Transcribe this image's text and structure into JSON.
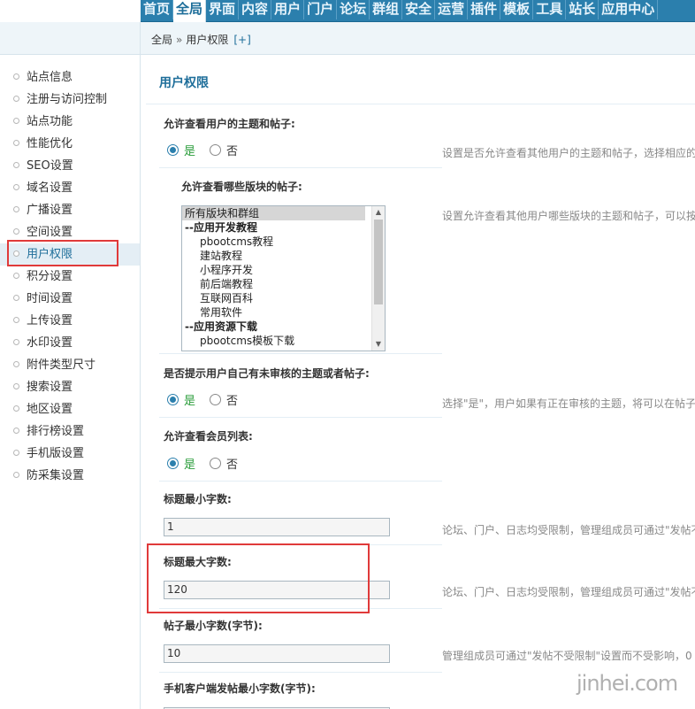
{
  "topnav": {
    "tabs": [
      {
        "label": "首页"
      },
      {
        "label": "全局"
      },
      {
        "label": "界面"
      },
      {
        "label": "内容"
      },
      {
        "label": "用户"
      },
      {
        "label": "门户"
      },
      {
        "label": "论坛"
      },
      {
        "label": "群组"
      },
      {
        "label": "安全"
      },
      {
        "label": "运营"
      },
      {
        "label": "插件"
      },
      {
        "label": "模板"
      },
      {
        "label": "工具"
      },
      {
        "label": "站长"
      },
      {
        "label": "应用中心"
      }
    ],
    "active": "全局"
  },
  "breadcrumb": {
    "root": "全局",
    "separator": "»",
    "current": "用户权限",
    "add": "[+]"
  },
  "sidebar": {
    "items": [
      {
        "label": "站点信息"
      },
      {
        "label": "注册与访问控制"
      },
      {
        "label": "站点功能"
      },
      {
        "label": "性能优化"
      },
      {
        "label": "SEO设置"
      },
      {
        "label": "域名设置"
      },
      {
        "label": "广播设置"
      },
      {
        "label": "空间设置"
      },
      {
        "label": "用户权限"
      },
      {
        "label": "积分设置"
      },
      {
        "label": "时间设置"
      },
      {
        "label": "上传设置"
      },
      {
        "label": "水印设置"
      },
      {
        "label": "附件类型尺寸"
      },
      {
        "label": "搜索设置"
      },
      {
        "label": "地区设置"
      },
      {
        "label": "排行榜设置"
      },
      {
        "label": "手机版设置"
      },
      {
        "label": "防采集设置"
      }
    ],
    "active": "用户权限"
  },
  "main": {
    "title": "用户权限",
    "settings": {
      "view_threads": {
        "label": "允许查看用户的主题和帖子:",
        "yes": "是",
        "no": "否",
        "selected": "是",
        "desc": "设置是否允许查看其他用户的主题和帖子，选择相应的"
      },
      "view_forums": {
        "label": "允许查看哪些版块的帖子:",
        "desc": "设置允许查看其他用户哪些版块的主题和帖子，可以按",
        "options": [
          {
            "text": "所有版块和群组",
            "kind": "selected"
          },
          {
            "text": "--应用开发教程",
            "kind": "group"
          },
          {
            "text": "pbootcms教程",
            "kind": "item"
          },
          {
            "text": "建站教程",
            "kind": "item"
          },
          {
            "text": "小程序开发",
            "kind": "item"
          },
          {
            "text": "前后端教程",
            "kind": "item"
          },
          {
            "text": "互联网百科",
            "kind": "item"
          },
          {
            "text": "常用软件",
            "kind": "item"
          },
          {
            "text": "--应用资源下载",
            "kind": "group"
          },
          {
            "text": "pbootcms模板下载",
            "kind": "item"
          }
        ]
      },
      "notify_unaudited": {
        "label": "是否提示用户自己有未审核的主题或者帖子:",
        "yes": "是",
        "no": "否",
        "selected": "是",
        "desc": "选择\"是\"，用户如果有正在审核的主题，将可以在帖子"
      },
      "view_memberlist": {
        "label": "允许查看会员列表:",
        "yes": "是",
        "no": "否",
        "selected": "是"
      },
      "title_min": {
        "label": "标题最小字数:",
        "value": "1",
        "desc": "论坛、门户、日志均受限制，管理组成员可通过\"发帖不"
      },
      "title_max": {
        "label": "标题最大字数:",
        "value": "120",
        "desc": "论坛、门户、日志均受限制，管理组成员可通过\"发帖不"
      },
      "post_min": {
        "label": "帖子最小字数(字节):",
        "value": "10",
        "desc": "管理组成员可通过\"发帖不受限制\"设置而不受影响，0"
      },
      "mobile_post_min": {
        "label": "手机客户端发帖最小字数(字节):"
      }
    }
  },
  "watermark": "jinhei.com",
  "colors": {
    "nav_bg": "#2b7fad",
    "accent": "#1e6e9a",
    "highlight_box": "#e03a3a",
    "yes_text": "#2a9c3a"
  }
}
